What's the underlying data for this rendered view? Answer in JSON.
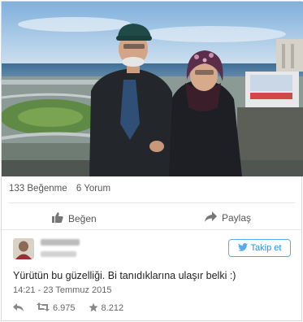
{
  "stats": {
    "likes": "133 Beğenme",
    "comments": "6 Yorum"
  },
  "actions": {
    "like": "Beğen",
    "share": "Paylaş"
  },
  "tweet": {
    "follow_label": "Takip et",
    "text": "Yürütün bu güzelliği. Bi tanıdıklarına ulaşır belki :)",
    "date": "14:21 - 23 Temmuz 2015",
    "retweets": "6.975",
    "favorites": "8.212"
  },
  "icons": {
    "like": "thumbs-up-icon",
    "share": "share-arrow-icon",
    "twitter": "twitter-bird-icon",
    "reply": "reply-icon",
    "retweet": "retweet-icon",
    "favorite": "star-icon"
  },
  "colors": {
    "twitter_blue": "#55acee",
    "follow_text": "#1b95e0"
  }
}
